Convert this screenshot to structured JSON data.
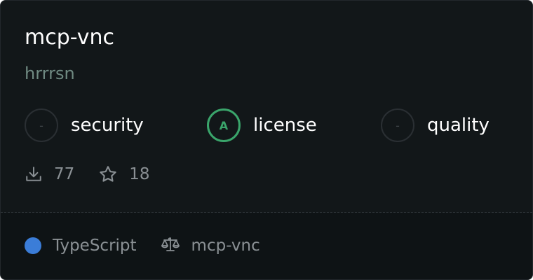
{
  "package": {
    "name": "mcp-vnc",
    "author": "hrrrsn"
  },
  "scores": [
    {
      "label": "security",
      "grade": "-"
    },
    {
      "label": "license",
      "grade": "A"
    },
    {
      "label": "quality",
      "grade": "-"
    }
  ],
  "stats": {
    "downloads": "77",
    "stars": "18"
  },
  "footer": {
    "language": "TypeScript",
    "language_color": "#3b7dd8",
    "license_name": "mcp-vnc"
  },
  "colors": {
    "card_background": "#121719",
    "grade_a": "#3aa56b"
  },
  "icons": [
    "download-icon",
    "star-icon",
    "scale-icon"
  ]
}
